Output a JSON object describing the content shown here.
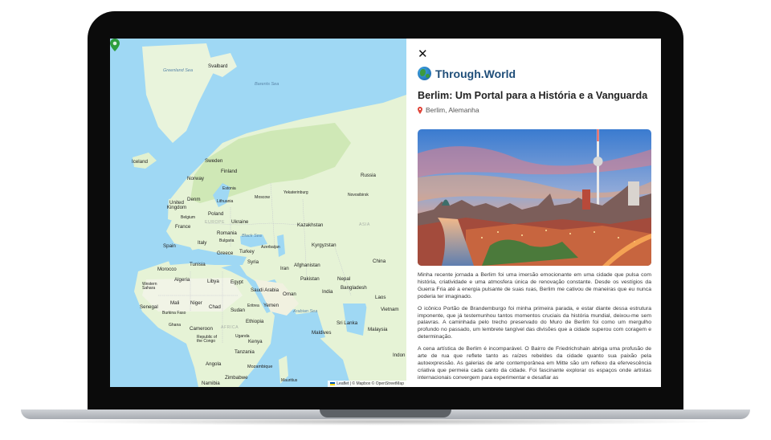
{
  "map": {
    "attribution": "Leaflet | © Mapbox © OpenStreetMap",
    "labels": {
      "svalbard": "Svalbard",
      "greenland_sea": "Greenland Sea",
      "barents_sea": "Barents Sea",
      "iceland": "Iceland",
      "sweden": "Sweden",
      "finland": "Finland",
      "norway": "Norway",
      "russia": "Russia",
      "estonia": "Estonia",
      "denmark": "Denm",
      "lithuania": "Lithuania",
      "moscow": "Moscow",
      "yekaterinburg": "Yekaterinburg",
      "novosibirsk": "Novosibirsk",
      "united_kingdom": "United Kingdom",
      "belgium": "Belgium",
      "poland": "Poland",
      "ukraine": "Ukraine",
      "europe": "EUROPE",
      "france": "France",
      "kazakhstan": "Kazakhstan",
      "romania": "Romania",
      "bulgaria": "Bulgaria",
      "asia": "ASIA",
      "spain": "Spain",
      "italy": "Italy",
      "black_sea": "Black Sea",
      "kyrgyzstan": "Kyrgyzstan",
      "greece": "Greece",
      "turkey": "Turkey",
      "azerbaijan": "Azerbaijan",
      "morocco": "Morocco",
      "tunisia": "Tunisia",
      "syria": "Syria",
      "afghanistan": "Afghanistan",
      "china": "China",
      "iran": "Iran",
      "algeria": "Algeria",
      "libya": "Libya",
      "egypt": "Egypt",
      "pakistan": "Pakistan",
      "nepal": "Nepal",
      "western_sahara": "Western Sahara",
      "saudi_arabia": "Saudi Arabia",
      "bangladesh": "Bangladesh",
      "india": "India",
      "mali": "Mali",
      "niger": "Niger",
      "oman": "Oman",
      "laos": "Laos",
      "senegal": "Senegal",
      "chad": "Chad",
      "sudan": "Sudan",
      "eritrea": "Eritrea",
      "yemen": "Yemen",
      "vietnam": "Vietnam",
      "burkina_faso": "Burkina Faso",
      "arabian_sea": "Arabian Sea",
      "ghana": "Ghana",
      "ethiopia": "Ethiopia",
      "sri_lanka": "Sri Lanka",
      "africa": "AFRICA",
      "maldives": "Maldives",
      "malaysia": "Malaysia",
      "cameroon": "Cameroon",
      "uganda": "Uganda",
      "republic_congo": "Republic of the Congo",
      "kenya": "Kenya",
      "tanzania": "Tanzania",
      "indonesia": "Indon",
      "angola": "Angola",
      "mozambique": "Mozambique",
      "zimbabwe": "Zimbabwe",
      "namibia": "Namibia",
      "mauritius": "Mauritius"
    },
    "pin_icon": "map-marker-icon"
  },
  "panel": {
    "close_label": "✕",
    "brand": "Through.World",
    "title": "Berlim: Um Portal para a História e a Vanguarda",
    "location": "Berlim, Alemanha",
    "paragraphs": [
      "Minha recente jornada a Berlim foi uma imersão emocionante em uma cidade que pulsa com história, criatividade e uma atmosfera única de renovação constante. Desde os vestígios da Guerra Fria até a energia pulsante de suas ruas, Berlim me cativou de maneiras que eu nunca poderia ter imaginado.",
      "O icônico Portão de Brandemburgo foi minha primeira parada, e estar diante dessa estrutura imponente, que já testemunhou tantos momentos cruciais da história mundial, deixou-me sem palavras. A caminhada pelo trecho preservado do Muro de Berlim foi como um mergulho profundo no passado, um lembrete tangível das divisões que a cidade superou com coragem e determinação.",
      "A cena artística de Berlim é incomparável. O Bairro de Friedrichshain abriga uma profusão de arte de rua que reflete tanto as raízes rebeldes da cidade quanto sua paixão pela autoexpressão. As galerias de arte contemporânea em Mitte são um reflexo da efervescência criativa que permeia cada canto da cidade. Foi fascinante explorar os espaços onde artistas internacionais convergem para experimentar e desafiar as"
    ]
  },
  "colors": {
    "ocean": "#9fd8f4",
    "land": "#e6f3d6",
    "land_dark": "#cfe8b6",
    "brand": "#1f4e79",
    "pin": "#2e9e3e",
    "location_pin": "#e0453a"
  }
}
